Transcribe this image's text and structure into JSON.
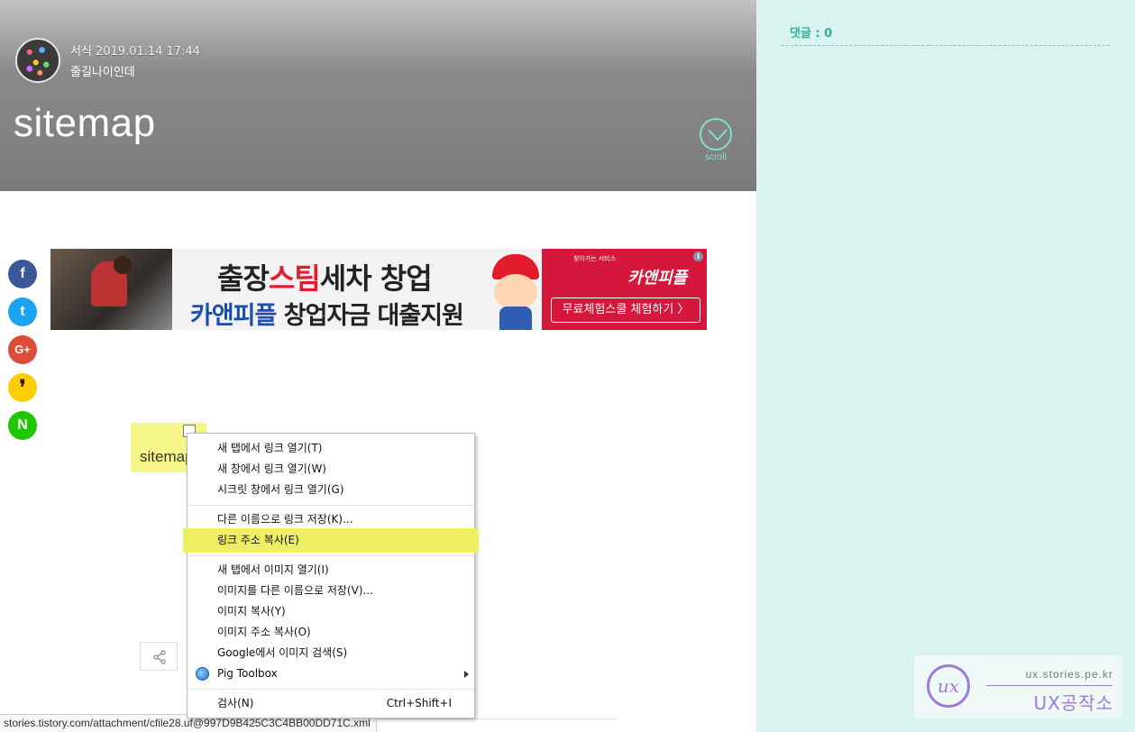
{
  "post": {
    "category": "서식",
    "date": "2019.01.14 17:44",
    "author": "줄길나이인데",
    "title": "sitemap",
    "scroll_label": "scroll"
  },
  "sidebar": {
    "comment_count": "댓글 : 0"
  },
  "share_buttons": [
    {
      "name": "facebook",
      "glyph": "f",
      "color": "#3b5998"
    },
    {
      "name": "twitter",
      "glyph": "t",
      "color": "#1da1f2"
    },
    {
      "name": "google-plus",
      "glyph": "G+",
      "color": "#dd4b39"
    },
    {
      "name": "kakaostory",
      "glyph": "❜",
      "color": "#ffcd00"
    },
    {
      "name": "naver",
      "glyph": "N",
      "color": "#1ec800"
    }
  ],
  "ad": {
    "headline_pre": "출장",
    "headline_red": "스팀",
    "headline_post": "세차 창업",
    "sub_brand": "카앤피플",
    "sub_rest": " 창업자금 대출지원",
    "tagline": "찾아가는 서비스",
    "brand": "카앤피플",
    "cta": "무료체험스쿨 체험하기 〉",
    "info": "i"
  },
  "attachment": {
    "link_text": "sitemap"
  },
  "context_menu": {
    "groups": [
      [
        {
          "label": "새 탭에서 링크 열기(T)"
        },
        {
          "label": "새 창에서 링크 열기(W)"
        },
        {
          "label": "시크릿 창에서 링크 열기(G)"
        }
      ],
      [
        {
          "label": "다른 이름으로 링크 저장(K)..."
        },
        {
          "label": "링크 주소 복사(E)",
          "highlighted": true
        }
      ],
      [
        {
          "label": "새 탭에서 이미지 열기(I)"
        },
        {
          "label": "이미지를 다른 이름으로 저장(V)..."
        },
        {
          "label": "이미지 복사(Y)"
        },
        {
          "label": "이미지 주소 복사(O)"
        },
        {
          "label": "Google에서 이미지 검색(S)"
        },
        {
          "label": "Pig Toolbox",
          "submenu": true,
          "icon": "pig-toolbox-icon"
        }
      ],
      [
        {
          "label": "검사(N)",
          "shortcut": "Ctrl+Shift+I"
        }
      ]
    ]
  },
  "status_bar": {
    "url": "stories.tistory.com/attachment/cfile28.uf@997D9B425C3C4BB00DD71C.xml"
  },
  "watermark": {
    "url": "ux.stories.pe.kr",
    "name": "UX공작소",
    "logo": "ux"
  }
}
